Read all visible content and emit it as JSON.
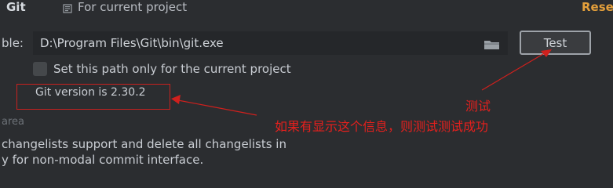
{
  "header": {
    "title": "Git",
    "scope_label": "For current project",
    "reset_label": "Reset"
  },
  "path_row": {
    "label": "ble:",
    "value": "D:\\Program Files\\Git\\bin\\git.exe",
    "test_label": "Test"
  },
  "checkbox": {
    "label": "Set this path only for the current project"
  },
  "version": {
    "text": "Git version is 2.30.2"
  },
  "annotations": {
    "label_1": "测试",
    "label_2": "如果有显示这个信息，则测试测试成功",
    "color": "#e5201d"
  },
  "lower": {
    "area_text": "area",
    "line_1": "changelists support and delete all changelists in",
    "line_2": "y for non-modal commit interface."
  },
  "colors": {
    "background": "#2b2d30",
    "input_background": "#25272a",
    "accent_reset": "#e39f3b",
    "annotation_red": "#e5201d"
  }
}
